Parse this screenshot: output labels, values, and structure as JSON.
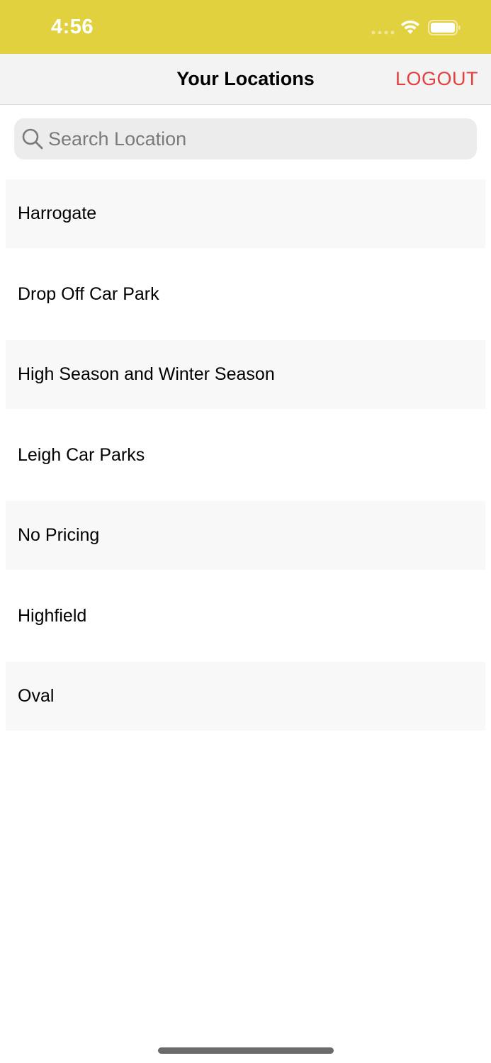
{
  "status_bar": {
    "time": "4:56",
    "background_color": "#e2d13f",
    "icons": [
      "signal-icon",
      "wifi-icon",
      "battery-icon"
    ]
  },
  "nav_bar": {
    "title": "Your Locations",
    "logout_label": "LOGOUT",
    "logout_color": "#e5403f"
  },
  "search": {
    "placeholder": "Search Location",
    "value": "",
    "icon": "search-icon"
  },
  "locations": [
    {
      "name": "Harrogate"
    },
    {
      "name": "Drop Off Car Park"
    },
    {
      "name": "High Season and Winter Season"
    },
    {
      "name": "Leigh Car Parks"
    },
    {
      "name": "No Pricing"
    },
    {
      "name": "Highfield"
    },
    {
      "name": "Oval"
    }
  ]
}
